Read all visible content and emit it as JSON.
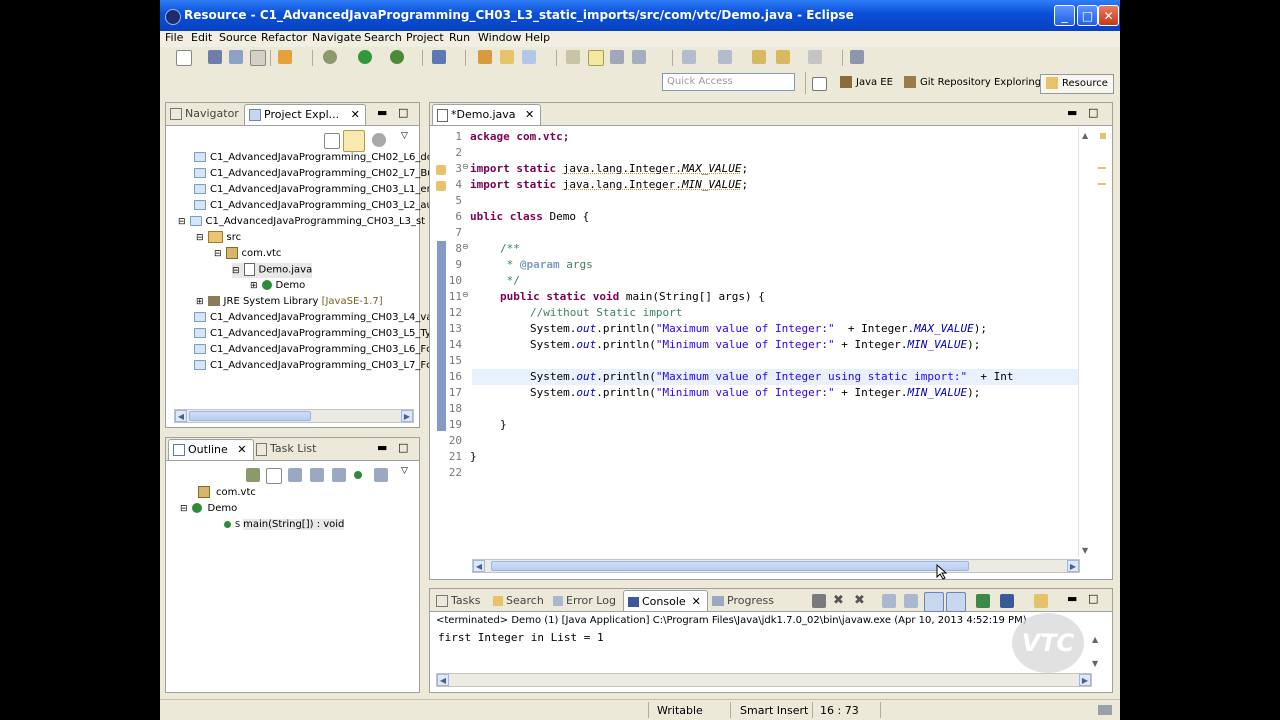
{
  "window": {
    "title": "Resource - C1_AdvancedJavaProgramming_CH03_L3_static_imports/src/com/vtc/Demo.java - Eclipse"
  },
  "menu": [
    "File",
    "Edit",
    "Source",
    "Refactor",
    "Navigate",
    "Search",
    "Project",
    "Run",
    "Window",
    "Help"
  ],
  "quick_access": {
    "placeholder": "Quick Access"
  },
  "perspectives": [
    "Java EE",
    "Git Repository Exploring",
    "Resource"
  ],
  "left_top": {
    "tabs": [
      "Navigator",
      "Project Expl..."
    ],
    "tree": [
      "C1_AdvancedJavaProgramming_CH02_L6_dc",
      "C1_AdvancedJavaProgramming_CH02_L7_Bu",
      "C1_AdvancedJavaProgramming_CH03_L1_er",
      "C1_AdvancedJavaProgramming_CH03_L2_au",
      "C1_AdvancedJavaProgramming_CH03_L3_st",
      "src",
      "com.vtc",
      "Demo.java",
      "Demo",
      "JRE System Library",
      "C1_AdvancedJavaProgramming_CH03_L4_va",
      "C1_AdvancedJavaProgramming_CH03_L5_Ty",
      "C1_AdvancedJavaProgramming_CH03_L6_Fc",
      "C1_AdvancedJavaProgramming_CH03_L7_Fc"
    ],
    "jre_version": "[JavaSE-1.7]"
  },
  "outline": {
    "tabs": [
      "Outline",
      "Task List"
    ],
    "items": [
      "com.vtc",
      "Demo",
      "main(String[]) : void"
    ],
    "static_mark": "S"
  },
  "editor": {
    "tab": "*Demo.java",
    "line_numbers": [
      "1",
      "2",
      "3",
      "4",
      "5",
      "6",
      "7",
      "8",
      "9",
      "10",
      "11",
      "12",
      "13",
      "14",
      "15",
      "16",
      "17",
      "18",
      "19",
      "20",
      "21",
      "22"
    ],
    "code": {
      "l1": "ackage com.vtc;",
      "l3a": "import static ",
      "l3b": "java.lang.Integer.",
      "l3c": "MAX_VALUE",
      "l3d": ";",
      "l4a": "import static ",
      "l4b": "java.lang.Integer.",
      "l4c": "MIN_VALUE",
      "l4d": ";",
      "l6a": "ublic class ",
      "l6b": "Demo {",
      "l8": "/**",
      "l9a": " * ",
      "l9b": "@param",
      "l9c": " args",
      "l10": " */",
      "l11a": "public static void ",
      "l11b": "main(String[] args) {",
      "l12": "//without Static import",
      "l13a": "System.",
      "l13b": "out",
      "l13c": ".println(",
      "l13d": "\"Maximum value of Integer:\"",
      "l13e": "  + Integer.",
      "l13f": "MAX_VALUE",
      "l13g": ");",
      "l14a": "System.",
      "l14b": "out",
      "l14c": ".println(",
      "l14d": "\"Minimum value of Integer:\"",
      "l14e": " + Integer.",
      "l14f": "MIN_VALUE",
      "l14g": ");",
      "l16a": "System.",
      "l16b": "out",
      "l16c": ".println(",
      "l16d": "\"Maximum value of Integer using static import:\"",
      "l16e": "  + Int",
      "l17a": "System.",
      "l17b": "out",
      "l17c": ".println(",
      "l17d": "\"Minimum value of Integer:\"",
      "l17e": " + Integer.",
      "l17f": "MIN_VALUE",
      "l17g": ");",
      "l19": "}",
      "l21": "}"
    }
  },
  "console": {
    "tabs": [
      "Tasks",
      "Search",
      "Error Log",
      "Console",
      "Progress"
    ],
    "header": "<terminated> Demo (1) [Java Application] C:\\Program Files\\Java\\jdk1.7.0_02\\bin\\javaw.exe (Apr 10, 2013 4:52:19 PM)",
    "output": "first Integer in List = 1",
    "watermark": "VTC"
  },
  "status": {
    "writable": "Writable",
    "insert_mode": "Smart Insert",
    "position": "16 : 73"
  },
  "colors": {
    "keyword": "#7f0055",
    "string": "#2a00ff",
    "comment": "#3f7f5f",
    "field": "#0000c0",
    "title_bar": "#0a4fd6"
  }
}
